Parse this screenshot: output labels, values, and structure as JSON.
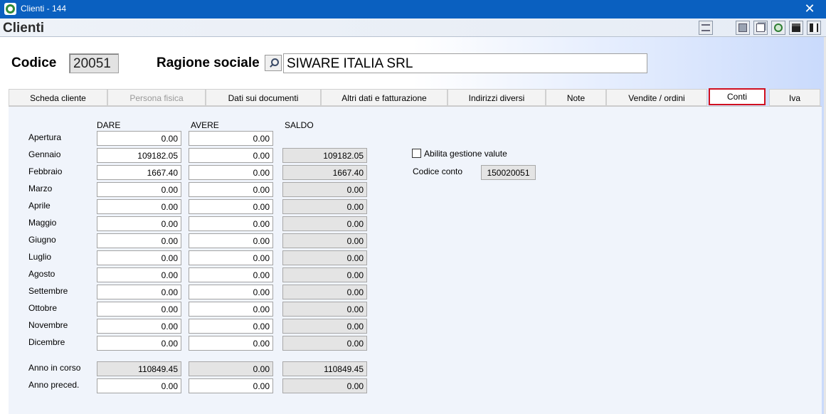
{
  "window": {
    "title": "Clienti - 144",
    "close_glyph": "✕"
  },
  "header": {
    "heading": "Clienti"
  },
  "toolbar": [
    "list-icon",
    "form-icon",
    "copy-icon",
    "refresh-icon",
    "save-icon",
    "exit-icon"
  ],
  "client": {
    "code_label": "Codice",
    "code_value": "20051",
    "name_label": "Ragione sociale",
    "name_value": "SIWARE ITALIA SRL"
  },
  "tabs": [
    {
      "label": "Scheda cliente",
      "state": "normal"
    },
    {
      "label": "Persona fisica",
      "state": "disabled"
    },
    {
      "label": "Dati sui documenti",
      "state": "normal"
    },
    {
      "label": "Altri dati e fatturazione",
      "state": "normal"
    },
    {
      "label": "Indirizzi diversi",
      "state": "normal"
    },
    {
      "label": "Note",
      "state": "normal"
    },
    {
      "label": "Vendite / ordini",
      "state": "normal"
    },
    {
      "label": "Conti",
      "state": "active"
    },
    {
      "label": "Iva",
      "state": "normal"
    }
  ],
  "conti": {
    "headers": {
      "dare": "DARE",
      "avere": "AVERE",
      "saldo": "SALDO"
    },
    "rows": [
      {
        "label": "Apertura",
        "dare": "0.00",
        "avere": "0.00",
        "saldo": null
      },
      {
        "label": "Gennaio",
        "dare": "109182.05",
        "avere": "0.00",
        "saldo": "109182.05"
      },
      {
        "label": "Febbraio",
        "dare": "1667.40",
        "avere": "0.00",
        "saldo": "1667.40"
      },
      {
        "label": "Marzo",
        "dare": "0.00",
        "avere": "0.00",
        "saldo": "0.00"
      },
      {
        "label": "Aprile",
        "dare": "0.00",
        "avere": "0.00",
        "saldo": "0.00"
      },
      {
        "label": "Maggio",
        "dare": "0.00",
        "avere": "0.00",
        "saldo": "0.00"
      },
      {
        "label": "Giugno",
        "dare": "0.00",
        "avere": "0.00",
        "saldo": "0.00"
      },
      {
        "label": "Luglio",
        "dare": "0.00",
        "avere": "0.00",
        "saldo": "0.00"
      },
      {
        "label": "Agosto",
        "dare": "0.00",
        "avere": "0.00",
        "saldo": "0.00"
      },
      {
        "label": "Settembre",
        "dare": "0.00",
        "avere": "0.00",
        "saldo": "0.00"
      },
      {
        "label": "Ottobre",
        "dare": "0.00",
        "avere": "0.00",
        "saldo": "0.00"
      },
      {
        "label": "Novembre",
        "dare": "0.00",
        "avere": "0.00",
        "saldo": "0.00"
      },
      {
        "label": "Dicembre",
        "dare": "0.00",
        "avere": "0.00",
        "saldo": "0.00"
      }
    ],
    "totals": [
      {
        "label": "Anno in corso",
        "dare": "110849.45",
        "avere": "0.00",
        "saldo": "110849.45",
        "readonly": true
      },
      {
        "label": "Anno preced.",
        "dare": "0.00",
        "avere": "0.00",
        "saldo": "0.00",
        "readonly": false
      }
    ],
    "valute_label": "Abilita gestione valute",
    "valute_checked": false,
    "codice_conto_label": "Codice conto",
    "codice_conto_value": "150020051"
  }
}
